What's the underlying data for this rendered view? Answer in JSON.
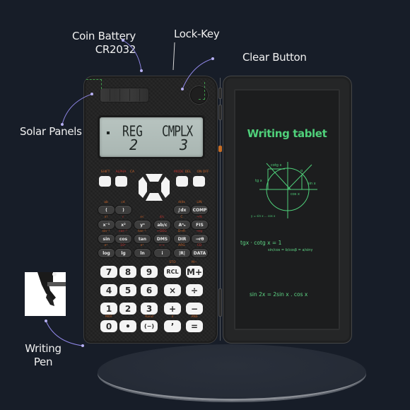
{
  "callouts": {
    "coin_battery": [
      "Coin Battery",
      "CR2032"
    ],
    "lock_key": "Lock-Key",
    "clear_button": "Clear Button",
    "solar_panels": "Solar Panels",
    "writing_pen": [
      "Writing",
      "Pen"
    ]
  },
  "colors": {
    "background": "#171d28",
    "callout_line": "#8f86e6",
    "tablet_ink": "#4fd07a",
    "shift_label": "#c8632a",
    "alpha_label": "#c0322e"
  },
  "calculator": {
    "display": {
      "indicator": "•",
      "modes": [
        "REG",
        "CMPLX"
      ],
      "values": [
        "2",
        "3"
      ]
    },
    "top_row_labels": [
      "SHIFT",
      "ALPHA",
      "CA",
      "MODE",
      "DEL",
      "ON OFF"
    ],
    "func_rows": [
      {
        "keys": [
          "(",
          ")",
          "",
          "",
          "∫dx",
          "COMP"
        ],
        "subs": [
          "ab",
          "cd",
          "",
          "",
          "d/dx",
          "LIN"
        ]
      },
      {
        "keys": [
          "x⁻¹",
          "x²",
          "yˣ",
          "ab/c",
          "Aⁿₙ",
          "FIS"
        ],
        "subs": [
          "x!",
          "√",
          "x√",
          "d/c",
          "C",
          "→%"
        ]
      },
      {
        "keys": [
          "sin",
          "cos",
          "tan",
          "DMS",
          "DIR",
          "→rθ"
        ],
        "subs": [
          "sin⁻¹",
          "cos⁻¹",
          "tan⁻¹",
          "←DEG",
          "D→R",
          "→xy"
        ]
      },
      {
        "keys": [
          "log",
          "lg",
          "ln",
          "i",
          "|R|",
          "DATA"
        ],
        "subs": [
          "eˣ",
          "10ˣ",
          "eˣ",
          "←→",
          "ARG",
          "CD"
        ]
      }
    ],
    "num_rows": [
      {
        "keys": [
          "7",
          "8",
          "9",
          "RCL",
          "M+"
        ],
        "subs": [
          "",
          "",
          "",
          "STO",
          "M−"
        ]
      },
      {
        "keys": [
          "4",
          "5",
          "6",
          "×",
          "÷"
        ],
        "subs": [
          "",
          "",
          "",
          "",
          ""
        ]
      },
      {
        "keys": [
          "1",
          "2",
          "3",
          "+",
          "−"
        ],
        "subs": [
          "",
          "",
          "",
          "",
          ""
        ]
      },
      {
        "keys": [
          "0",
          "•",
          "(−)",
          "’",
          "="
        ],
        "subs": [
          "MOF",
          "",
          "Rand",
          "π",
          "ANS"
        ]
      }
    ]
  },
  "tablet": {
    "title": "Writing tablet",
    "diagram_labels": {
      "cotg": "cotg x",
      "tg": "tg x",
      "alpha": "α",
      "sin": "sin x",
      "cos": "cos x",
      "note": "y = sin x ... cos x"
    },
    "formula_1": "tgx · cotg x = 1",
    "formula_1b": "sin/cos = b/cosβ = a/sinγ",
    "formula_2": "sin 2x = 2sin x . cos x"
  }
}
